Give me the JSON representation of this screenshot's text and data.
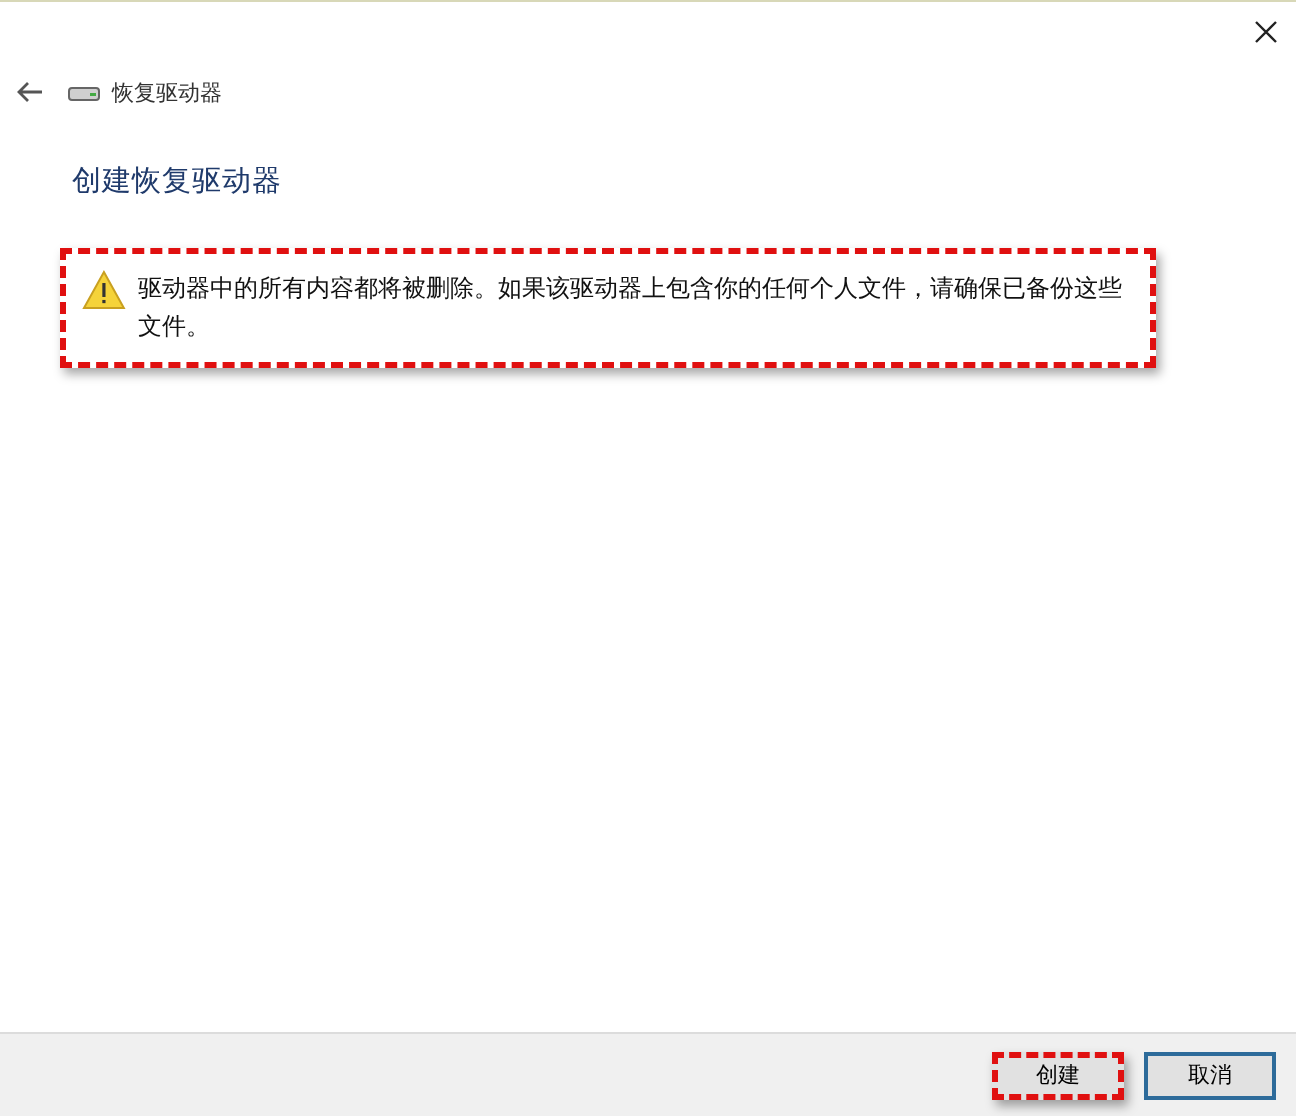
{
  "breadcrumb": {
    "title": "恢复驱动器"
  },
  "heading": "创建恢复驱动器",
  "warning": {
    "text": "驱动器中的所有内容都将被删除。如果该驱动器上包含你的任何个人文件，请确保已备份这些文件。",
    "highlighted": true
  },
  "buttons": [
    {
      "label": "创建",
      "highlighted": true,
      "focused": false
    },
    {
      "label": "取消",
      "highlighted": false,
      "focused": true
    }
  ]
}
